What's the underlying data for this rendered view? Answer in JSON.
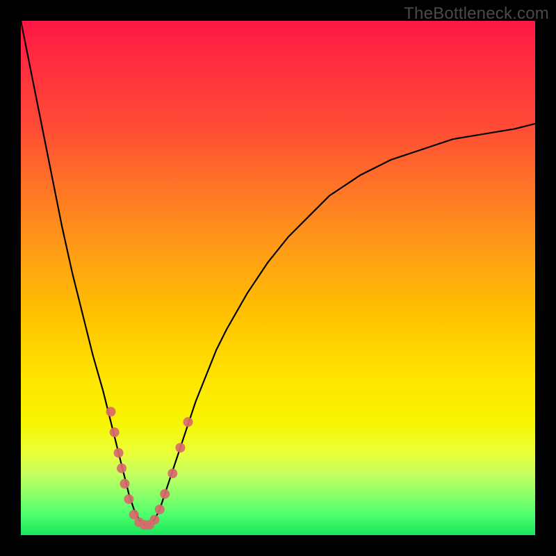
{
  "watermark": "TheBottleneck.com",
  "chart_data": {
    "type": "line",
    "title": "",
    "xlabel": "",
    "ylabel": "",
    "xlim": [
      0,
      100
    ],
    "ylim": [
      0,
      100
    ],
    "series": [
      {
        "name": "bottleneck-curve",
        "x": [
          0,
          2,
          4,
          6,
          8,
          10,
          12,
          14,
          16,
          18,
          19,
          20,
          21,
          22,
          23,
          24,
          25,
          26,
          27,
          28,
          30,
          32,
          34,
          36,
          38,
          40,
          44,
          48,
          52,
          56,
          60,
          66,
          72,
          78,
          84,
          90,
          96,
          100
        ],
        "values": [
          100,
          90,
          80,
          70,
          60,
          51,
          43,
          35,
          28,
          20,
          16,
          12,
          8,
          5,
          3,
          2,
          2,
          3,
          5,
          8,
          14,
          20,
          26,
          31,
          36,
          40,
          47,
          53,
          58,
          62,
          66,
          70,
          73,
          75,
          77,
          78,
          79,
          80
        ]
      }
    ],
    "markers": {
      "name": "highlighted-points",
      "color": "#d86a6a",
      "points": [
        {
          "x": 17.5,
          "y": 24
        },
        {
          "x": 18.2,
          "y": 20
        },
        {
          "x": 19.0,
          "y": 16
        },
        {
          "x": 19.6,
          "y": 13
        },
        {
          "x": 20.2,
          "y": 10
        },
        {
          "x": 21.0,
          "y": 7
        },
        {
          "x": 22.0,
          "y": 4
        },
        {
          "x": 23.0,
          "y": 2.5
        },
        {
          "x": 24.0,
          "y": 2
        },
        {
          "x": 25.0,
          "y": 2
        },
        {
          "x": 26.0,
          "y": 3
        },
        {
          "x": 27.0,
          "y": 5
        },
        {
          "x": 28.0,
          "y": 8
        },
        {
          "x": 29.5,
          "y": 12
        },
        {
          "x": 31.0,
          "y": 17
        },
        {
          "x": 32.5,
          "y": 22
        }
      ]
    },
    "background_gradient": {
      "top": "#ff1744",
      "upper_mid": "#ffa114",
      "mid": "#ffe600",
      "lower_mid": "#c6ff5e",
      "bottom": "#18e65a"
    }
  }
}
